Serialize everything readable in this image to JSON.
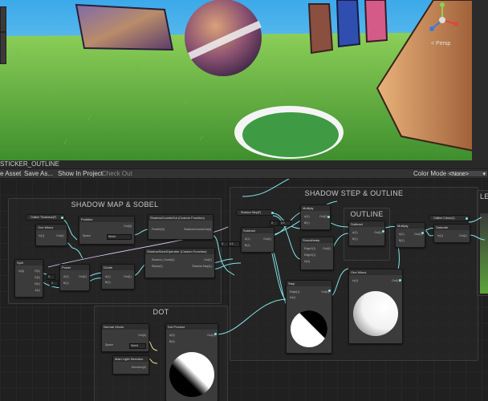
{
  "scene_view": {
    "projection_label": "< Persp",
    "colors": {
      "sky": "#5fb6e8",
      "grass": "#5cae3a"
    }
  },
  "graph_window": {
    "tab_title": "STICKER_OUTLINE",
    "toolbar": {
      "save_asset": "e Asset",
      "save_as": "Save As...",
      "show_in_project": "Show In Project",
      "check_out": "Check Out",
      "color_mode_label": "Color Mode",
      "color_mode_value": "<None>"
    }
  },
  "groups": {
    "shadow_map": "SHADOW MAP & SOBEL",
    "shadow_step": "SHADOW STEP & OUTLINE",
    "outline": "OUTLINE",
    "dot": "DOT",
    "right_partial": "LE"
  },
  "properties": {
    "outline_thickness": "Outline Thickness(F)",
    "shadow_step": "Shadow Step(F)",
    "outline_color": "Outline Colour(4)"
  },
  "nodes": {
    "one_minus_a": {
      "title": "One Minus",
      "in": "In(1)",
      "out": "Out(1)"
    },
    "posmax": {
      "title": "PosMax",
      "out": "Out(3)",
      "space_label": "Space",
      "space_value": "World"
    },
    "shadowcoordout": {
      "title": "ShadowCoordsOut (Custom Function)",
      "in": "PosWS(3)",
      "out": "ShadowCoordsOut(4)"
    },
    "shadow_sobel": {
      "title": "ShadowSobelOperator (Custom Function)",
      "in1": "Shadow_Coord(4)",
      "in2": "Stylus(1)",
      "out1": "Out(1)",
      "out2": "Shadow Map(1)"
    },
    "split": {
      "title": "Split",
      "in": "In(4)",
      "r": "R(1)",
      "g": "G(1)",
      "b": "B(1)",
      "a": "A(1)"
    },
    "power": {
      "title": "Power",
      "a": "A(1)",
      "b": "B(1)",
      "out": "Out(1)"
    },
    "divide": {
      "title": "Divide",
      "a": "A(1)",
      "b": "B(1)",
      "out": "Out(1)"
    },
    "subtract": {
      "title": "Subtract",
      "a": "A(1)",
      "b": "B(1)",
      "out": "Out(1)"
    },
    "multiply_a": {
      "title": "Multiply",
      "a": "A(1)",
      "b": "B(1)",
      "out": "Out(1)"
    },
    "smoothstep": {
      "title": "Smoothstep",
      "e1": "Edge1(1)",
      "e2": "Edge2(1)",
      "in": "In(1)",
      "out": "Out(1)"
    },
    "subtract_b": {
      "title": "Subtract",
      "a": "A(1)",
      "b": "B(1)",
      "out": "Out(1)"
    },
    "multiply_b": {
      "title": "Multiply",
      "a": "A(1)",
      "b": "B(1)",
      "out": "Out(1)"
    },
    "saturate": {
      "title": "Saturate",
      "in": "In(1)",
      "out": "Out(1)"
    },
    "step": {
      "title": "Step",
      "edge": "Edge(1)",
      "in": "In(1)",
      "out": "Out(1)"
    },
    "one_minus_b": {
      "title": "One Minus",
      "in": "In(1)",
      "out": "Out(1)"
    },
    "normal_vector": {
      "title": "Normal Vector",
      "out": "Out(3)",
      "space_label": "Space",
      "space_value": "World"
    },
    "main_light": {
      "title": "Main Light Direction",
      "out": "Direction(3)"
    },
    "dot_product": {
      "title": "Dot Product",
      "a": "A(3)",
      "b": "B(3)",
      "out": "Out(1)"
    }
  },
  "inline_values": {
    "x_label": "X",
    "power_b": "2",
    "sub_x": "X",
    "sub_val": "0.1",
    "step_b": "0.1",
    "sm_x": "X"
  },
  "wire_color": "#84e4e7"
}
